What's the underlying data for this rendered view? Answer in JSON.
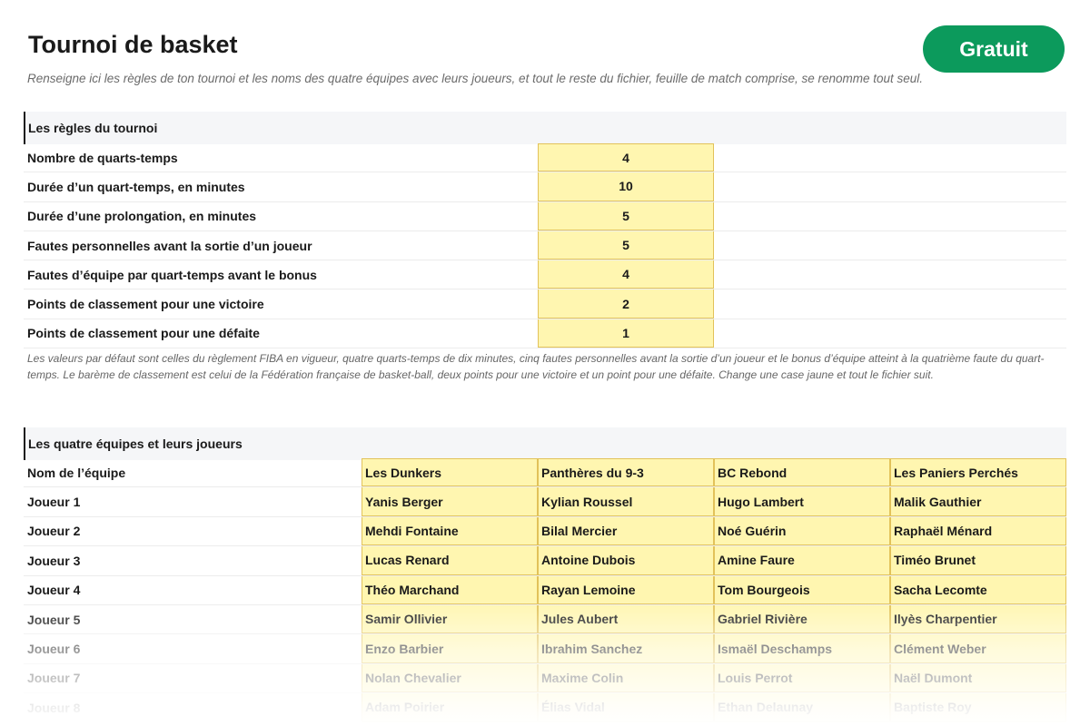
{
  "header": {
    "title": "Tournoi de basket",
    "subtitle": "Renseigne ici les règles de ton tournoi et les noms des quatre équipes avec leurs joueurs, et tout le reste du fichier, feuille de match comprise, se renomme tout seul.",
    "badge": "Gratuit"
  },
  "colors": {
    "badge": "#0c9a5c",
    "input_fill": "#fff6b0",
    "input_border": "#e2c25a"
  },
  "rules": {
    "heading": "Les règles du tournoi",
    "rows": [
      {
        "label": "Nombre de quarts-temps",
        "value": "4"
      },
      {
        "label": "Durée d’un quart-temps, en minutes",
        "value": "10"
      },
      {
        "label": "Durée d’une prolongation, en minutes",
        "value": "5"
      },
      {
        "label": "Fautes personnelles avant la sortie d’un joueur",
        "value": "5"
      },
      {
        "label": "Fautes d’équipe par quart-temps avant le bonus",
        "value": "4"
      },
      {
        "label": "Points de classement pour une victoire",
        "value": "2"
      },
      {
        "label": "Points de classement pour une défaite",
        "value": "1"
      }
    ],
    "note": "Les valeurs par défaut sont celles du règlement FIBA en vigueur, quatre quarts-temps de dix minutes, cinq fautes personnelles avant la sortie d’un joueur et le bonus d’équipe atteint à la quatrième faute du quart-temps. Le barème de classement est celui de la Fédération française de basket-ball, deux points pour une victoire et un point pour une défaite. Change une case jaune et tout le fichier suit."
  },
  "teams": {
    "heading": "Les quatre équipes et leurs joueurs",
    "rows": [
      {
        "label": "Nom de l’équipe",
        "cells": [
          "Les Dunkers",
          "Panthères du 9-3",
          "BC Rebond",
          "Les Paniers Perchés"
        ]
      },
      {
        "label": "Joueur 1",
        "cells": [
          "Yanis Berger",
          "Kylian Roussel",
          "Hugo Lambert",
          "Malik Gauthier"
        ]
      },
      {
        "label": "Joueur 2",
        "cells": [
          "Mehdi Fontaine",
          "Bilal Mercier",
          "Noé Guérin",
          "Raphaël Ménard"
        ]
      },
      {
        "label": "Joueur 3",
        "cells": [
          "Lucas Renard",
          "Antoine Dubois",
          "Amine Faure",
          "Timéo Brunet"
        ]
      },
      {
        "label": "Joueur 4",
        "cells": [
          "Théo Marchand",
          "Rayan Lemoine",
          "Tom Bourgeois",
          "Sacha Lecomte"
        ]
      },
      {
        "label": "Joueur 5",
        "cells": [
          "Samir Ollivier",
          "Jules Aubert",
          "Gabriel Rivière",
          "Ilyès Charpentier"
        ]
      },
      {
        "label": "Joueur 6",
        "cells": [
          "Enzo Barbier",
          "Ibrahim Sanchez",
          "Ismaël Deschamps",
          "Clément Weber"
        ]
      },
      {
        "label": "Joueur 7",
        "cells": [
          "Nolan Chevalier",
          "Maxime Colin",
          "Louis Perrot",
          "Naël Dumont"
        ]
      },
      {
        "label": "Joueur 8",
        "cells": [
          "Adam Poirier",
          "Élias Vidal",
          "Ethan Delaunay",
          "Baptiste Roy"
        ]
      }
    ]
  }
}
